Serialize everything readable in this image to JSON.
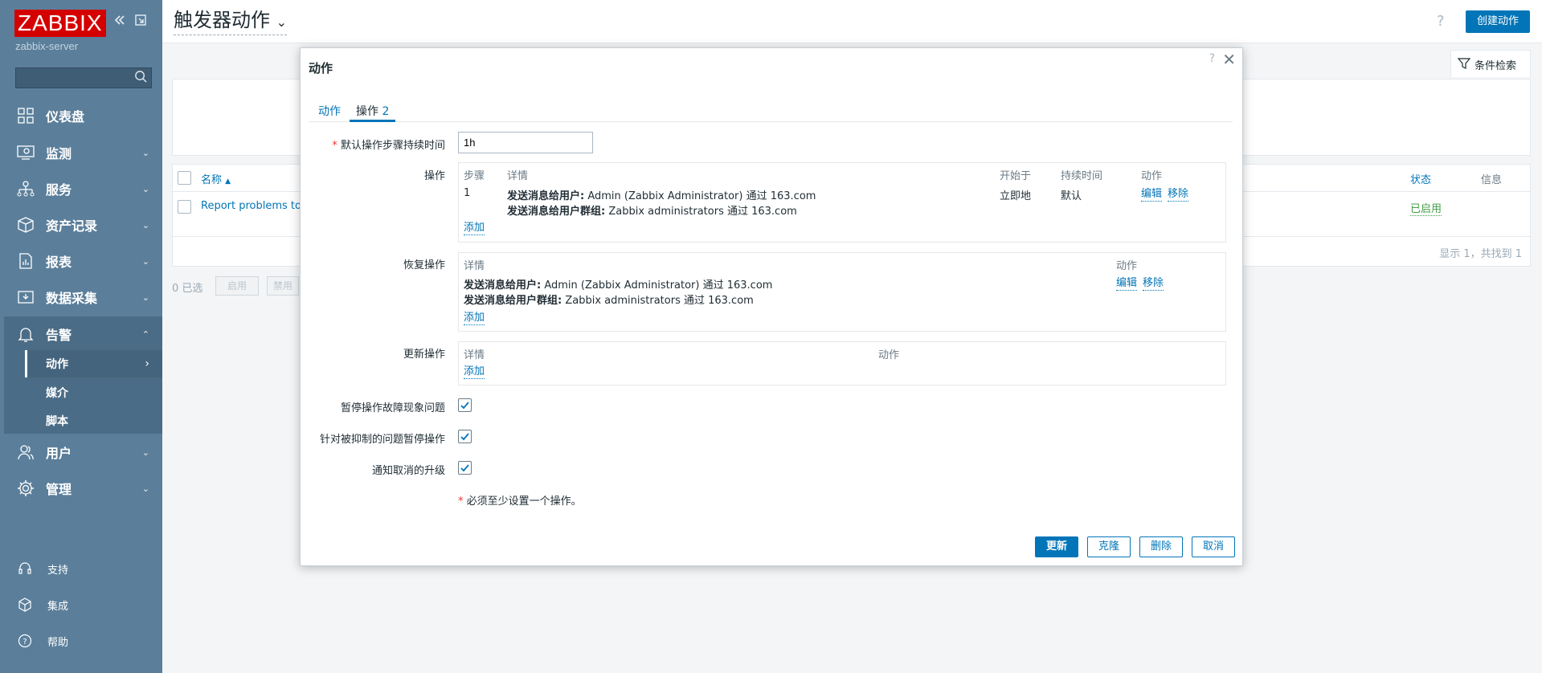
{
  "sidebar": {
    "logo": "ZABBIX",
    "server": "zabbix-server",
    "search_placeholder": "",
    "nav": [
      {
        "label": "仪表盘",
        "icon": "dashboard-icon"
      },
      {
        "label": "监测",
        "icon": "monitoring-icon"
      },
      {
        "label": "服务",
        "icon": "services-icon"
      },
      {
        "label": "资产记录",
        "icon": "inventory-icon"
      },
      {
        "label": "报表",
        "icon": "reports-icon"
      },
      {
        "label": "数据采集",
        "icon": "data-collection-icon"
      },
      {
        "label": "告警",
        "icon": "alerts-icon"
      },
      {
        "label": "用户",
        "icon": "users-icon"
      },
      {
        "label": "管理",
        "icon": "administration-icon"
      }
    ],
    "alert_sub": [
      "动作",
      "媒介",
      "脚本"
    ],
    "footer": [
      {
        "label": "支持",
        "icon": "support-icon"
      },
      {
        "label": "集成",
        "icon": "integrations-icon"
      },
      {
        "label": "帮助",
        "icon": "help-icon"
      }
    ]
  },
  "header": {
    "title": "触发器动作",
    "help": "?",
    "create_button": "创建动作",
    "filter_tab": "条件检索"
  },
  "list": {
    "col_name": "名称",
    "col_status": "状态",
    "col_info": "信息",
    "row_name": "Report problems to Z",
    "row_status": "已启用",
    "summary": "显示 1，共找到 1",
    "selected": "0 已选",
    "btn_enable": "启用",
    "btn_disable": "禁用"
  },
  "modal": {
    "title": "动作",
    "help": "?",
    "close": "✕",
    "tab_action": "动作",
    "tab_ops": "操作",
    "tab_ops_count": "2",
    "duration_label": "默认操作步骤持续时间",
    "duration_value": "1h",
    "ops_label": "操作",
    "ops_headers": {
      "step": "步骤",
      "details": "详情",
      "start": "开始于",
      "duration": "持续时间",
      "action": "动作"
    },
    "ops_row": {
      "step": "1",
      "line1_bold": "发送消息给用户:",
      "line1_rest": " Admin (Zabbix Administrator) 通过 163.com",
      "line2_bold": "发送消息给用户群组:",
      "line2_rest": " Zabbix administrators 通过 163.com",
      "start": "立即地",
      "duration": "默认",
      "edit": "编辑",
      "remove": "移除"
    },
    "add": "添加",
    "recovery_label": "恢复操作",
    "recovery_headers": {
      "details": "详情",
      "action": "动作"
    },
    "recovery_row": {
      "line1_bold": "发送消息给用户:",
      "line1_rest": " Admin (Zabbix Administrator) 通过 163.com",
      "line2_bold": "发送消息给用户群组:",
      "line2_rest": " Zabbix administrators 通过 163.com",
      "edit": "编辑",
      "remove": "移除"
    },
    "update_label": "更新操作",
    "update_headers": {
      "details": "详情",
      "action": "动作"
    },
    "pause_symptoms": "暂停操作故障现象问题",
    "pause_suppressed": "针对被抑制的问题暂停操作",
    "notify_cancelled": "通知取消的升级",
    "required_note": "必须至少设置一个操作。",
    "buttons": {
      "update": "更新",
      "clone": "克隆",
      "delete": "删除",
      "cancel": "取消"
    }
  }
}
